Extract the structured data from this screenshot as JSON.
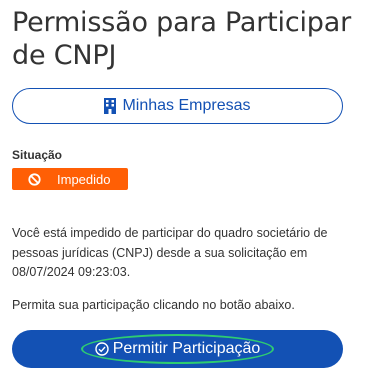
{
  "page": {
    "title": "Permissão para Participar de CNPJ"
  },
  "companies_button": {
    "label": "Minhas Empresas",
    "icon": "building-icon"
  },
  "status": {
    "label": "Situação",
    "badge_text": "Impedido",
    "badge_icon": "block-icon",
    "badge_color": "#ff5f05"
  },
  "description": "Você está impedido de participar do quadro societário de pessoas jurídicas (CNPJ) desde a sua solicitação em 08/07/2024 09:23:03.",
  "hint": "Permita sua participação clicando no botão abaixo.",
  "allow_button": {
    "label": "Permitir Participação",
    "icon": "check-circle-icon",
    "color": "#1351b4",
    "highlight_color": "#2ecc71"
  }
}
